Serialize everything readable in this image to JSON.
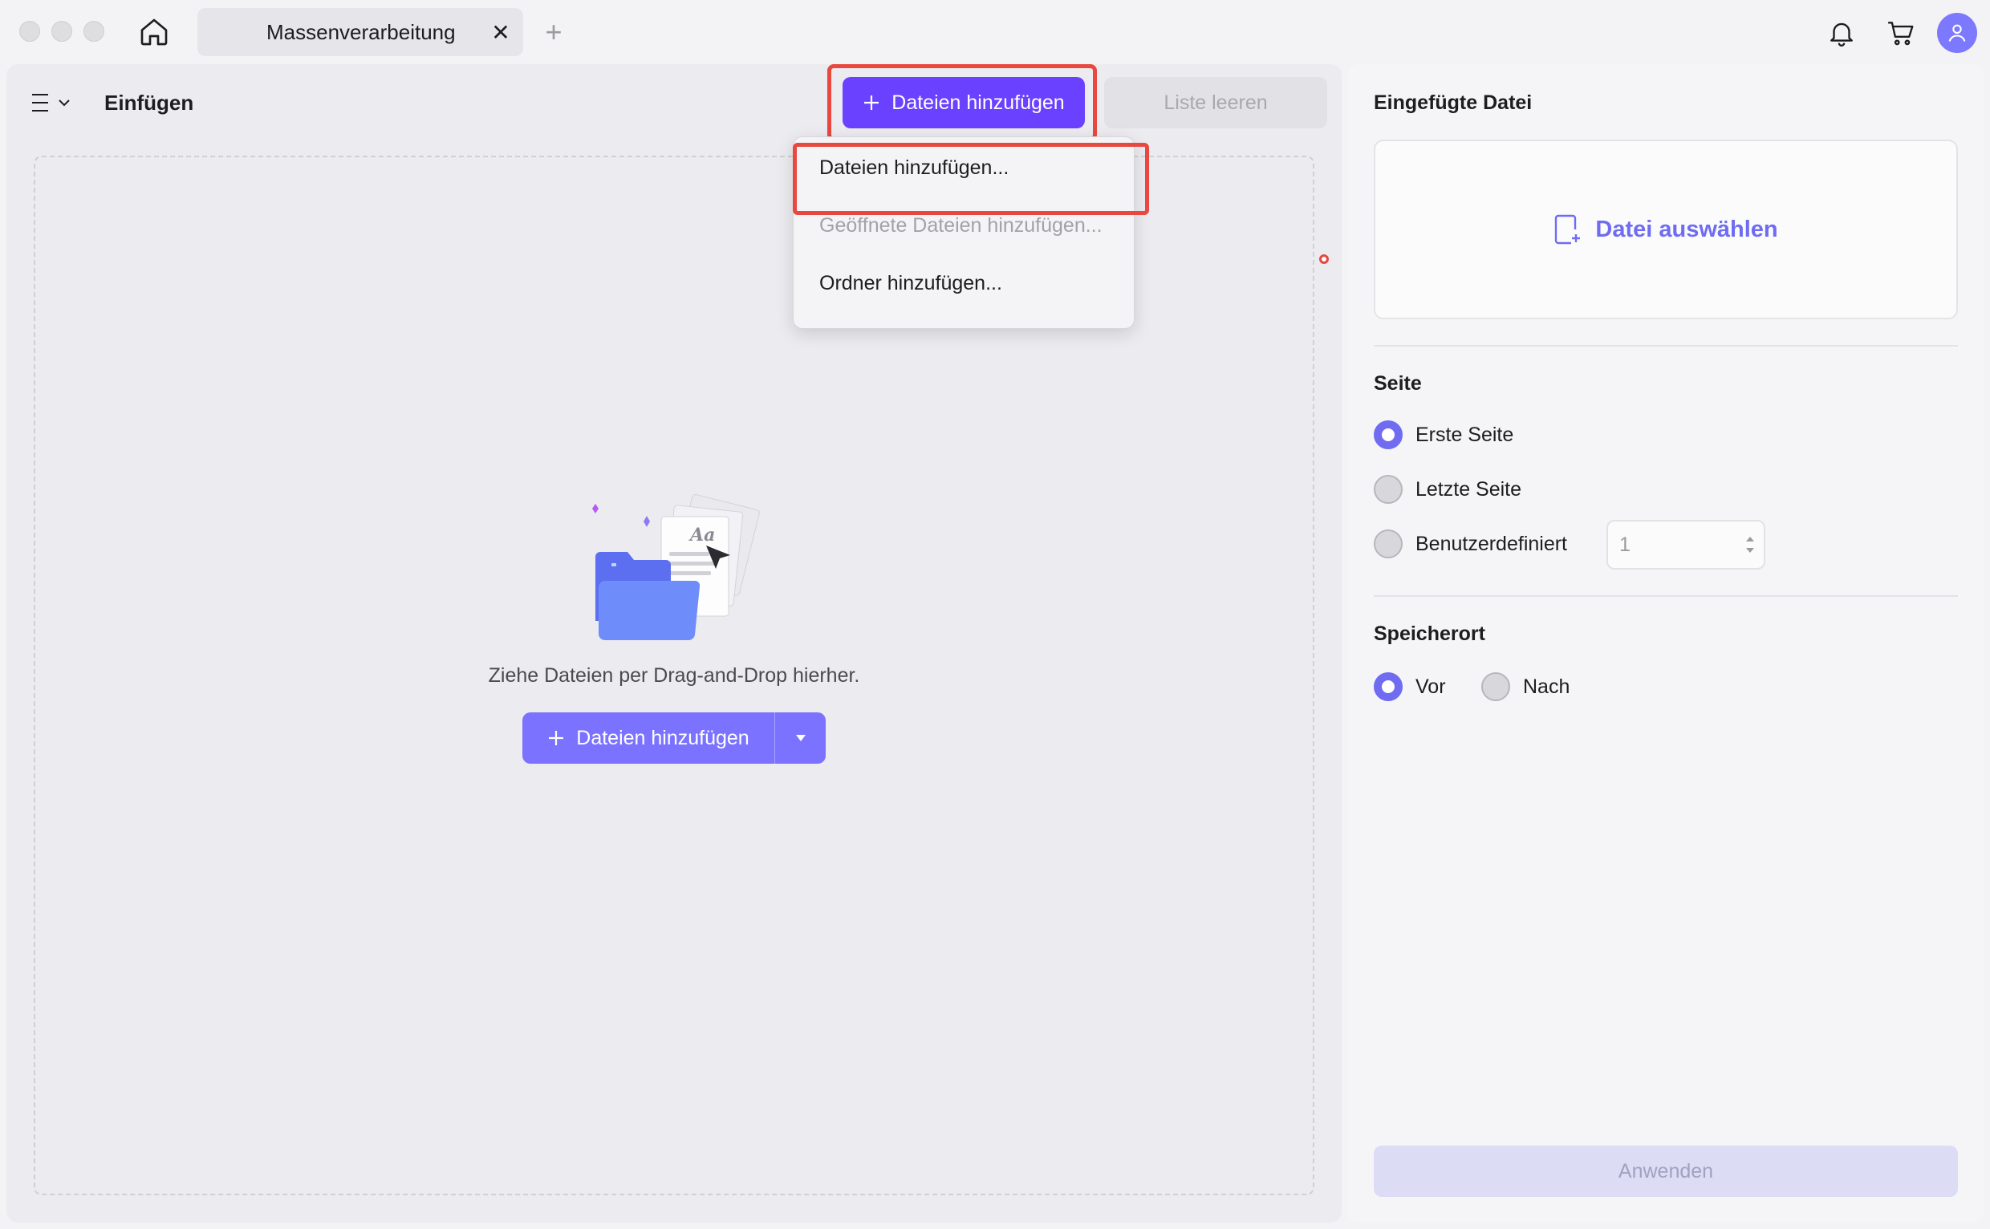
{
  "window": {
    "tab_title": "Massenverarbeitung",
    "tab_close": "✕",
    "tab_add": "+"
  },
  "toolbar": {
    "title": "Einfügen",
    "add_files_label": "Dateien hinzufügen",
    "clear_list_label": "Liste leeren"
  },
  "add_menu": {
    "items": [
      {
        "label": "Dateien hinzufügen...",
        "enabled": true
      },
      {
        "label": "Geöffnete Dateien hinzufügen...",
        "enabled": false
      },
      {
        "label": "Ordner hinzufügen...",
        "enabled": true
      }
    ]
  },
  "dropzone": {
    "hint": "Ziehe Dateien per Drag-and-Drop hierher.",
    "button_label": "Dateien hinzufügen",
    "illustration_text": "Aa"
  },
  "right_panel": {
    "inserted_file_heading": "Eingefügte Datei",
    "choose_file_label": "Datei auswählen",
    "page_heading": "Seite",
    "page_options": [
      {
        "label": "Erste Seite",
        "selected": true
      },
      {
        "label": "Letzte Seite",
        "selected": false
      },
      {
        "label": "Benutzerdefiniert",
        "selected": false
      }
    ],
    "custom_page_value": "1",
    "location_heading": "Speicherort",
    "location_options": [
      {
        "label": "Vor",
        "selected": true
      },
      {
        "label": "Nach",
        "selected": false
      }
    ],
    "apply_label": "Anwenden"
  },
  "colors": {
    "accent": "#6a41ff",
    "accent_light": "#7b73ff",
    "highlight": "#e8483f",
    "radio_on": "#6f6cf2"
  }
}
